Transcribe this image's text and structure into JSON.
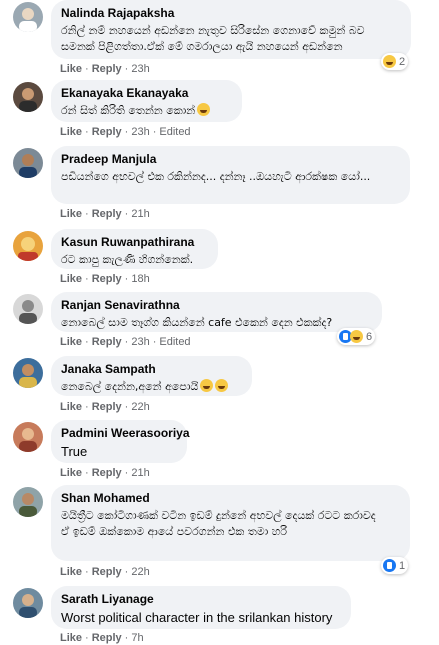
{
  "comments": [
    {
      "author": "Nalinda Rajapaksha",
      "text": "රනිල් නම් නහයෙන් අඩන්නෙ නැතුව සිරිසේන ගෙනාවේ කමුන් බව සමනක් පිළිගත්තා.ඒක් මේ ගමරාලයා ඇයි නහයෙන් අඩන්නෙ",
      "like": "Like",
      "reply": "Reply",
      "time": "23h",
      "edited": "",
      "reaction_count": "2",
      "reactions": [
        "haha"
      ]
    },
    {
      "author": "Ekanayaka Ekanayaka",
      "text": "රන් සිත් කිරිති තෙන්න කොන්",
      "like": "Like",
      "reply": "Reply",
      "time": "23h",
      "edited": "Edited",
      "reaction_count": "",
      "reactions": []
    },
    {
      "author": "Pradeep Manjula",
      "text": "පඩියන්ගෙ අභවල් එක රකින්නද... දන්නෑ ..ඔයහැටි ආරක්ෂක යෝ...",
      "like": "Like",
      "reply": "Reply",
      "time": "21h",
      "edited": "",
      "reaction_count": "",
      "reactions": []
    },
    {
      "author": "Kasun Ruwanpathirana",
      "text": "රට කාපු කැලණි හිගන්නෙක්.",
      "like": "Like",
      "reply": "Reply",
      "time": "18h",
      "edited": "",
      "reaction_count": "",
      "reactions": []
    },
    {
      "author": "Ranjan Senavirathna",
      "text": "නොබෙල් සාම තෑග්ග කියන්නේ cafe එකෙන් දෙන එකක්ද?",
      "like": "Like",
      "reply": "Reply",
      "time": "23h",
      "edited": "Edited",
      "reaction_count": "6",
      "reactions": [
        "like",
        "haha"
      ]
    },
    {
      "author": "Janaka Sampath",
      "text": "නෙබෙල් දෙන්න,අනේ අපොයි",
      "like": "Like",
      "reply": "Reply",
      "time": "22h",
      "edited": "",
      "reaction_count": "",
      "reactions": []
    },
    {
      "author": "Padmini Weerasooriya",
      "text": "True",
      "like": "Like",
      "reply": "Reply",
      "time": "21h",
      "edited": "",
      "reaction_count": "",
      "reactions": []
    },
    {
      "author": "Shan Mohamed",
      "text": "මයිත්‍රීට කෝටිගාණක් වටින ඉඩම් දුන්නේ අභවල් දෙයක් රටට කරාවද\nඒ ඉඩම් ඔක්කොම ආයේ පවරගන්න එක තමා හරි",
      "like": "Like",
      "reply": "Reply",
      "time": "22h",
      "edited": "",
      "reaction_count": "1",
      "reactions": [
        "like"
      ]
    },
    {
      "author": "Sarath Liyanage",
      "text": "Worst political character in the srilankan history",
      "like": "Like",
      "reply": "Reply",
      "time": "7h",
      "edited": "",
      "reaction_count": "",
      "reactions": []
    }
  ],
  "colors": {
    "bubble": "#f0f2f5",
    "meta": "#65676b",
    "like_blue": "#1877f2",
    "haha_yellow": "#f7c843"
  }
}
